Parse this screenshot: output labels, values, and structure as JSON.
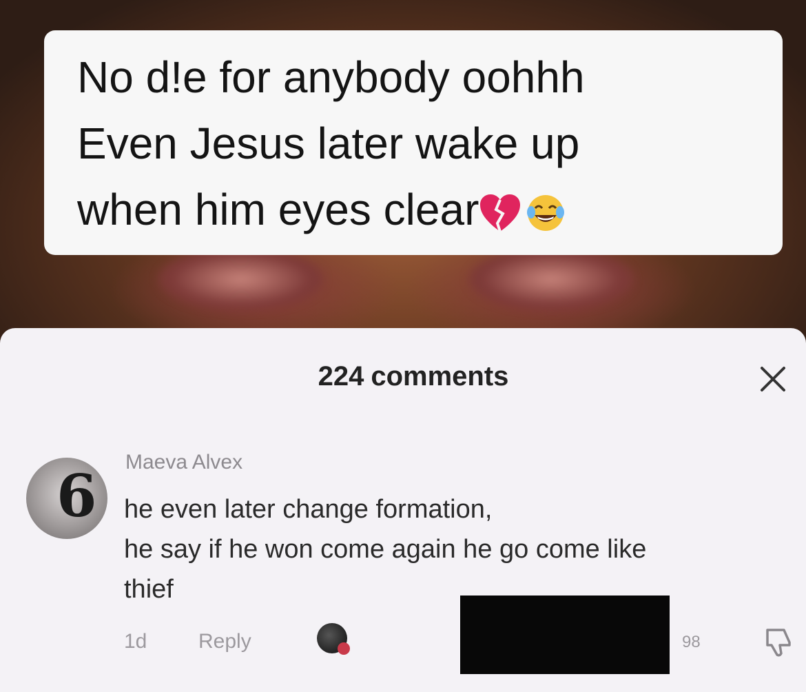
{
  "caption": {
    "lines": [
      "No d!e for anybody oohhh",
      "Even Jesus later wake up",
      "when him eyes clear"
    ],
    "emojis": [
      "broken-heart-icon",
      "tears-of-joy-icon"
    ]
  },
  "comments_sheet": {
    "count": "224",
    "count_label": "comments",
    "close_icon": "close-icon",
    "comment": {
      "author": "Maeva Alvex",
      "text_lines": [
        "he even later change formation,",
        "he say if he won come again he go come like",
        "thief"
      ],
      "time": "1d",
      "reply_label": "Reply",
      "like_count": "98"
    }
  },
  "colors": {
    "caption_bg": "#f7f7f7",
    "sheet_bg": "#f4f2f6",
    "muted_text": "#9c999e",
    "redaction": "#080808"
  }
}
